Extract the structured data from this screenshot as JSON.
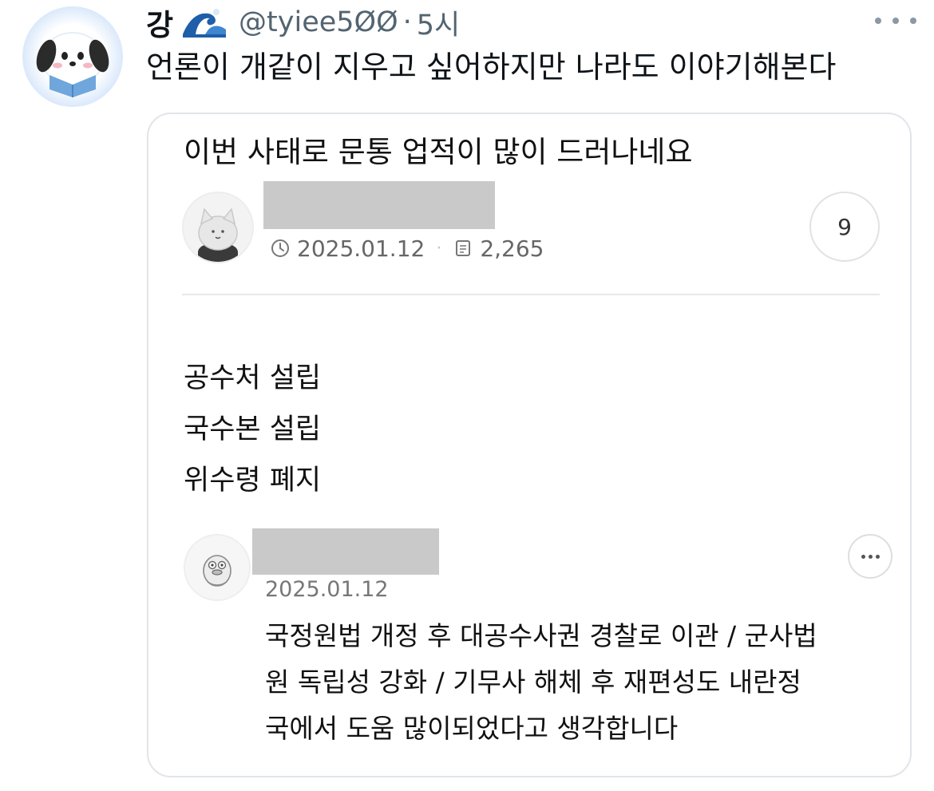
{
  "tweet": {
    "display_name": "강",
    "handle": "@tyiee5ØØ",
    "separator": "·",
    "time": "5시",
    "text": "언론이 개같이 지우고 싶어하지만 나라도 이야기해본다",
    "avatar_icon": "puppy-character-icon",
    "emoji_icon": "wave-emoji-icon"
  },
  "post_card": {
    "title": "이번 사태로 문통 업적이 많이 드러나네요",
    "date": "2025.01.12",
    "views": "2,265",
    "comment_count": "9",
    "body_lines": [
      "공수처 설립",
      "국수본 설립",
      "위수령 폐지"
    ],
    "comment": {
      "date": "2025.01.12",
      "lines": [
        "국정원법 개정 후 대공수사권 경찰로 이관 / 군사법",
        "원 독립성 강화 / 기무사 해체 후 재편성도 내란정",
        "국에서 도움 많이되었다고 생각합니다"
      ]
    }
  },
  "colors": {
    "secondary_text": "#536471",
    "card_border": "#e1e5e9",
    "redaction": "#c9c9c9"
  }
}
